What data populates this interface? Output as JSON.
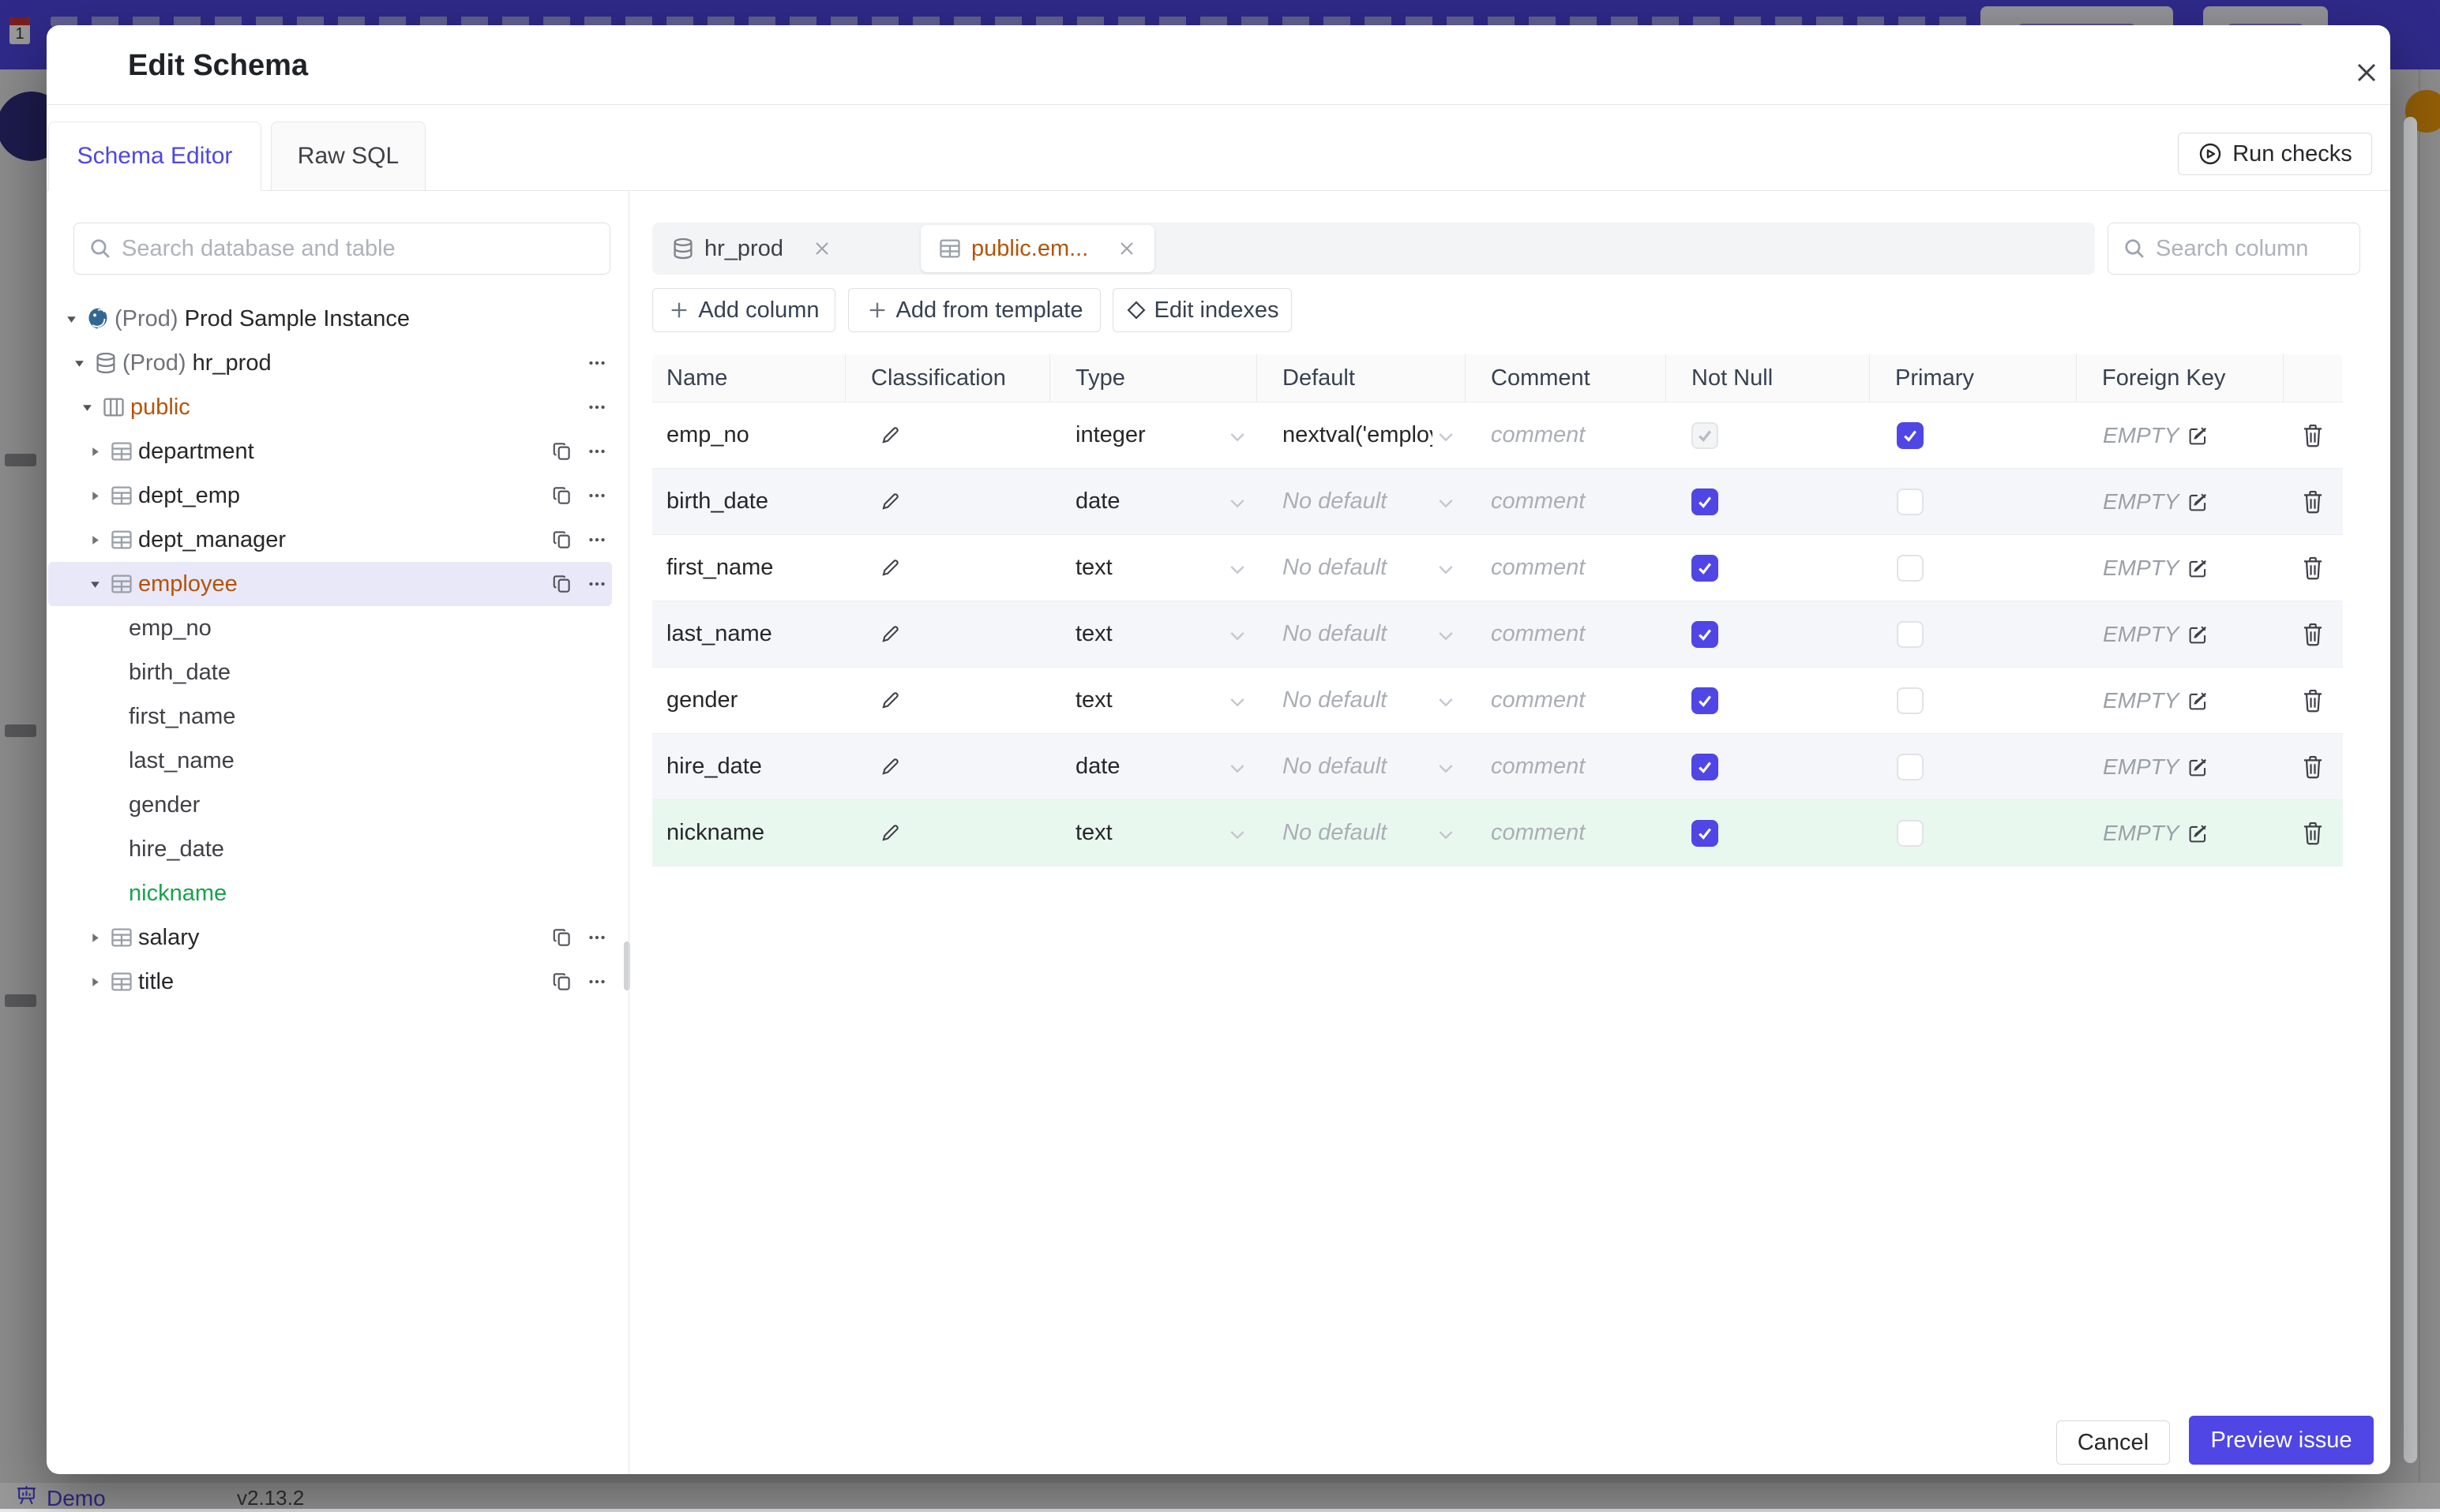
{
  "page": {
    "footer": {
      "demo_label": "Demo",
      "version": "v2.13.2"
    }
  },
  "modal": {
    "title": "Edit Schema",
    "tabs": [
      {
        "label": "Schema Editor",
        "active": true
      },
      {
        "label": "Raw SQL",
        "active": false
      }
    ],
    "run_checks_label": "Run checks",
    "sidebar": {
      "search_placeholder": "Search database and table",
      "tree": [
        {
          "prefix": "(Prod) ",
          "label": "Prod Sample Instance",
          "level": 0,
          "caret": "down",
          "icon": "postgres",
          "color": "default",
          "selected": false,
          "actions": []
        },
        {
          "prefix": "(Prod) ",
          "label": "hr_prod",
          "level": 1,
          "caret": "down",
          "icon": "database",
          "color": "default",
          "selected": false,
          "actions": [
            "dots"
          ]
        },
        {
          "prefix": "",
          "label": "public",
          "level": 2,
          "caret": "down",
          "icon": "schema",
          "color": "amber",
          "selected": false,
          "actions": [
            "dots"
          ]
        },
        {
          "prefix": "",
          "label": "department",
          "level": 3,
          "caret": "right",
          "icon": "table",
          "color": "default",
          "selected": false,
          "actions": [
            "copy",
            "dots"
          ]
        },
        {
          "prefix": "",
          "label": "dept_emp",
          "level": 3,
          "caret": "right",
          "icon": "table",
          "color": "default",
          "selected": false,
          "actions": [
            "copy",
            "dots"
          ]
        },
        {
          "prefix": "",
          "label": "dept_manager",
          "level": 3,
          "caret": "right",
          "icon": "table",
          "color": "default",
          "selected": false,
          "actions": [
            "copy",
            "dots"
          ]
        },
        {
          "prefix": "",
          "label": "employee",
          "level": 3,
          "caret": "down",
          "icon": "table",
          "color": "amber",
          "selected": true,
          "actions": [
            "copy",
            "dots"
          ]
        },
        {
          "prefix": "",
          "label": "emp_no",
          "level": 4,
          "caret": "none",
          "icon": "none",
          "color": "default",
          "selected": false,
          "actions": []
        },
        {
          "prefix": "",
          "label": "birth_date",
          "level": 4,
          "caret": "none",
          "icon": "none",
          "color": "default",
          "selected": false,
          "actions": []
        },
        {
          "prefix": "",
          "label": "first_name",
          "level": 4,
          "caret": "none",
          "icon": "none",
          "color": "default",
          "selected": false,
          "actions": []
        },
        {
          "prefix": "",
          "label": "last_name",
          "level": 4,
          "caret": "none",
          "icon": "none",
          "color": "default",
          "selected": false,
          "actions": []
        },
        {
          "prefix": "",
          "label": "gender",
          "level": 4,
          "caret": "none",
          "icon": "none",
          "color": "default",
          "selected": false,
          "actions": []
        },
        {
          "prefix": "",
          "label": "hire_date",
          "level": 4,
          "caret": "none",
          "icon": "none",
          "color": "default",
          "selected": false,
          "actions": []
        },
        {
          "prefix": "",
          "label": "nickname",
          "level": 4,
          "caret": "none",
          "icon": "none",
          "color": "green",
          "selected": false,
          "actions": []
        },
        {
          "prefix": "",
          "label": "salary",
          "level": 3,
          "caret": "right",
          "icon": "table",
          "color": "default",
          "selected": false,
          "actions": [
            "copy",
            "dots"
          ]
        },
        {
          "prefix": "",
          "label": "title",
          "level": 3,
          "caret": "right",
          "icon": "table",
          "color": "default",
          "selected": false,
          "actions": [
            "copy",
            "dots"
          ]
        }
      ]
    },
    "editor": {
      "open_tabs": [
        {
          "label": "hr_prod",
          "icon": "database",
          "active": false
        },
        {
          "label": "public.em...",
          "icon": "table",
          "active": true
        }
      ],
      "search_placeholder": "Search column",
      "toolbar": [
        {
          "label": "Add column",
          "icon": "plus"
        },
        {
          "label": "Add from template",
          "icon": "plus"
        },
        {
          "label": "Edit indexes",
          "icon": "diamond"
        }
      ],
      "table": {
        "headers": [
          "Name",
          "Classification",
          "Type",
          "Default",
          "Comment",
          "Not Null",
          "Primary",
          "Foreign Key"
        ],
        "no_default_placeholder": "No default",
        "comment_placeholder": "comment",
        "foreign_key_empty": "EMPTY",
        "rows": [
          {
            "name": "emp_no",
            "type": "integer",
            "default": "nextval('employ",
            "default_is_placeholder": false,
            "not_null": true,
            "not_null_disabled": true,
            "primary": true,
            "highlight": false
          },
          {
            "name": "birth_date",
            "type": "date",
            "default": "",
            "default_is_placeholder": true,
            "not_null": true,
            "not_null_disabled": false,
            "primary": false,
            "highlight": false
          },
          {
            "name": "first_name",
            "type": "text",
            "default": "",
            "default_is_placeholder": true,
            "not_null": true,
            "not_null_disabled": false,
            "primary": false,
            "highlight": false
          },
          {
            "name": "last_name",
            "type": "text",
            "default": "",
            "default_is_placeholder": true,
            "not_null": true,
            "not_null_disabled": false,
            "primary": false,
            "highlight": false
          },
          {
            "name": "gender",
            "type": "text",
            "default": "",
            "default_is_placeholder": true,
            "not_null": true,
            "not_null_disabled": false,
            "primary": false,
            "highlight": false
          },
          {
            "name": "hire_date",
            "type": "date",
            "default": "",
            "default_is_placeholder": true,
            "not_null": true,
            "not_null_disabled": false,
            "primary": false,
            "highlight": false
          },
          {
            "name": "nickname",
            "type": "text",
            "default": "",
            "default_is_placeholder": true,
            "not_null": true,
            "not_null_disabled": false,
            "primary": false,
            "highlight": true
          }
        ]
      }
    },
    "footer": {
      "cancel_label": "Cancel",
      "submit_label": "Preview issue"
    }
  },
  "colors": {
    "accent": "#4f46e5",
    "header_bar": "#4f46e5",
    "schema_amber": "#b45309",
    "added_green_text": "#16a34a",
    "added_row_bg": "#e9f8ef",
    "postgres_blue": "#336791"
  }
}
